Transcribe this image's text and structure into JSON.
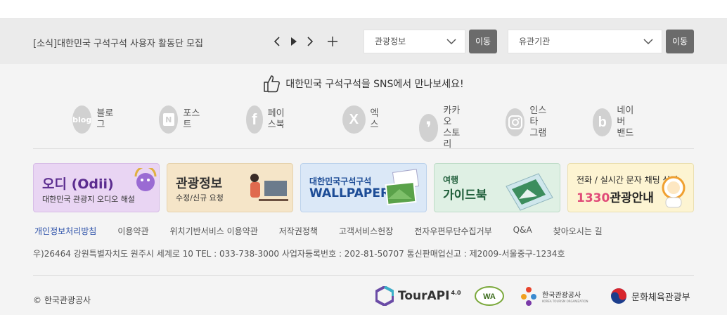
{
  "news": {
    "text": "[소식]대한민국 구석구석 사용자 활동단 모집",
    "prev_icon": "chevron-left-icon",
    "play_icon": "play-icon",
    "next_icon": "chevron-right-icon",
    "more_icon": "plus-icon"
  },
  "selects": [
    {
      "value": "관광정보",
      "button": "이동"
    },
    {
      "value": "유관기관",
      "button": "이동"
    }
  ],
  "sns": {
    "title": "대한민국 구석구석을 SNS에서 만나보세요!",
    "items": [
      {
        "label": "블로그",
        "icon": "blog-icon",
        "icon_text": "blog"
      },
      {
        "label": "포스트",
        "icon": "post-icon",
        "icon_text": "N"
      },
      {
        "label": "페이스북",
        "icon": "facebook-icon",
        "icon_text": "f"
      },
      {
        "label": "엑스",
        "icon": "x-icon",
        "icon_text": "X"
      },
      {
        "label": "카카오\n스토리",
        "icon": "kakaostory-icon",
        "icon_text": "❜"
      },
      {
        "label": "인스타\n그램",
        "icon": "instagram-icon",
        "icon_text": ""
      },
      {
        "label": "네이버\n밴드",
        "icon": "band-icon",
        "icon_text": "b"
      }
    ]
  },
  "banners": [
    {
      "title": "오디 (Odii)",
      "subtitle": "대한민국 관광지 오디오 해설",
      "color": "#5b2c8f"
    },
    {
      "title": "관광정보",
      "subtitle": "수정/신규 요청",
      "color": "#333333"
    },
    {
      "title": "대한민국구석구석",
      "subtitle": "WALLPAPER",
      "color": "#1d4c96"
    },
    {
      "title": "여행",
      "subtitle": "가이드북",
      "color": "#1f5e3a"
    },
    {
      "title": "전화 / 실시간 문자 채팅 상담",
      "subtitle1330": "1330",
      "subtitle": "관광안내",
      "color": "#222222"
    }
  ],
  "footer_links": [
    "개인정보처리방침",
    "이용약관",
    "위치기반서비스 이용약관",
    "저작권정책",
    "고객서비스헌장",
    "전자우편무단수집거부",
    "Q&A",
    "찾아오시는 길"
  ],
  "address": "우)26464   강원특별자치도 원주시 세계로 10   TEL : 033-738-3000   사업자등록번호 : 202-81-50707   통신판매업신고 : 제2009-서울중구-1234호",
  "copyright": "© 한국관광공사",
  "logos": {
    "tourapi": "TourAPI",
    "tourapi_version": "4.0",
    "wa": "WA",
    "kto": "한국관광공사",
    "kto_en": "KOREA TOURISM ORGANIZATION",
    "mcst": "문화체육관광부"
  },
  "colors": {
    "accent_link": "#2a4fa8",
    "button_gray": "#6b6b6b",
    "sns_gray": "#d1d1d1"
  }
}
